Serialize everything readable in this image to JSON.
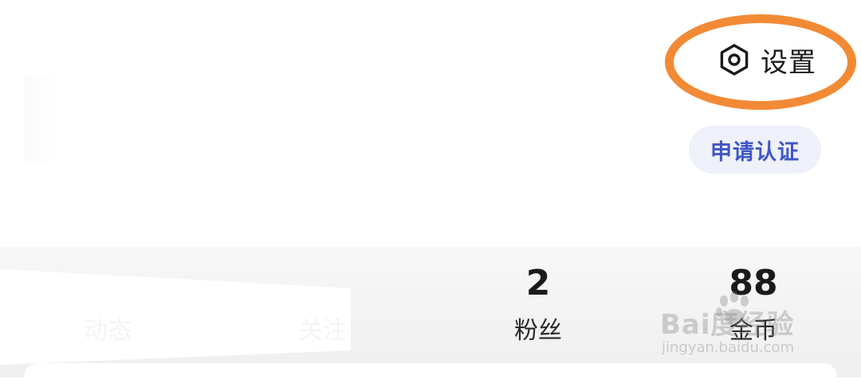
{
  "header": {
    "settings_label": "设置",
    "settings_icon": "gear-hexagon-icon",
    "highlight_color": "#f28a35"
  },
  "verify": {
    "label": "申请认证",
    "text_color": "#3f57c4",
    "background": "#eef0fa"
  },
  "stats": [
    {
      "label": "动态",
      "value": ""
    },
    {
      "label": "关注",
      "value": ""
    },
    {
      "label": "粉丝",
      "value": "2"
    },
    {
      "label": "金币",
      "value": "88"
    }
  ],
  "watermark": {
    "brand": "Bai度经验",
    "url": "jingyan.baidu.com"
  }
}
